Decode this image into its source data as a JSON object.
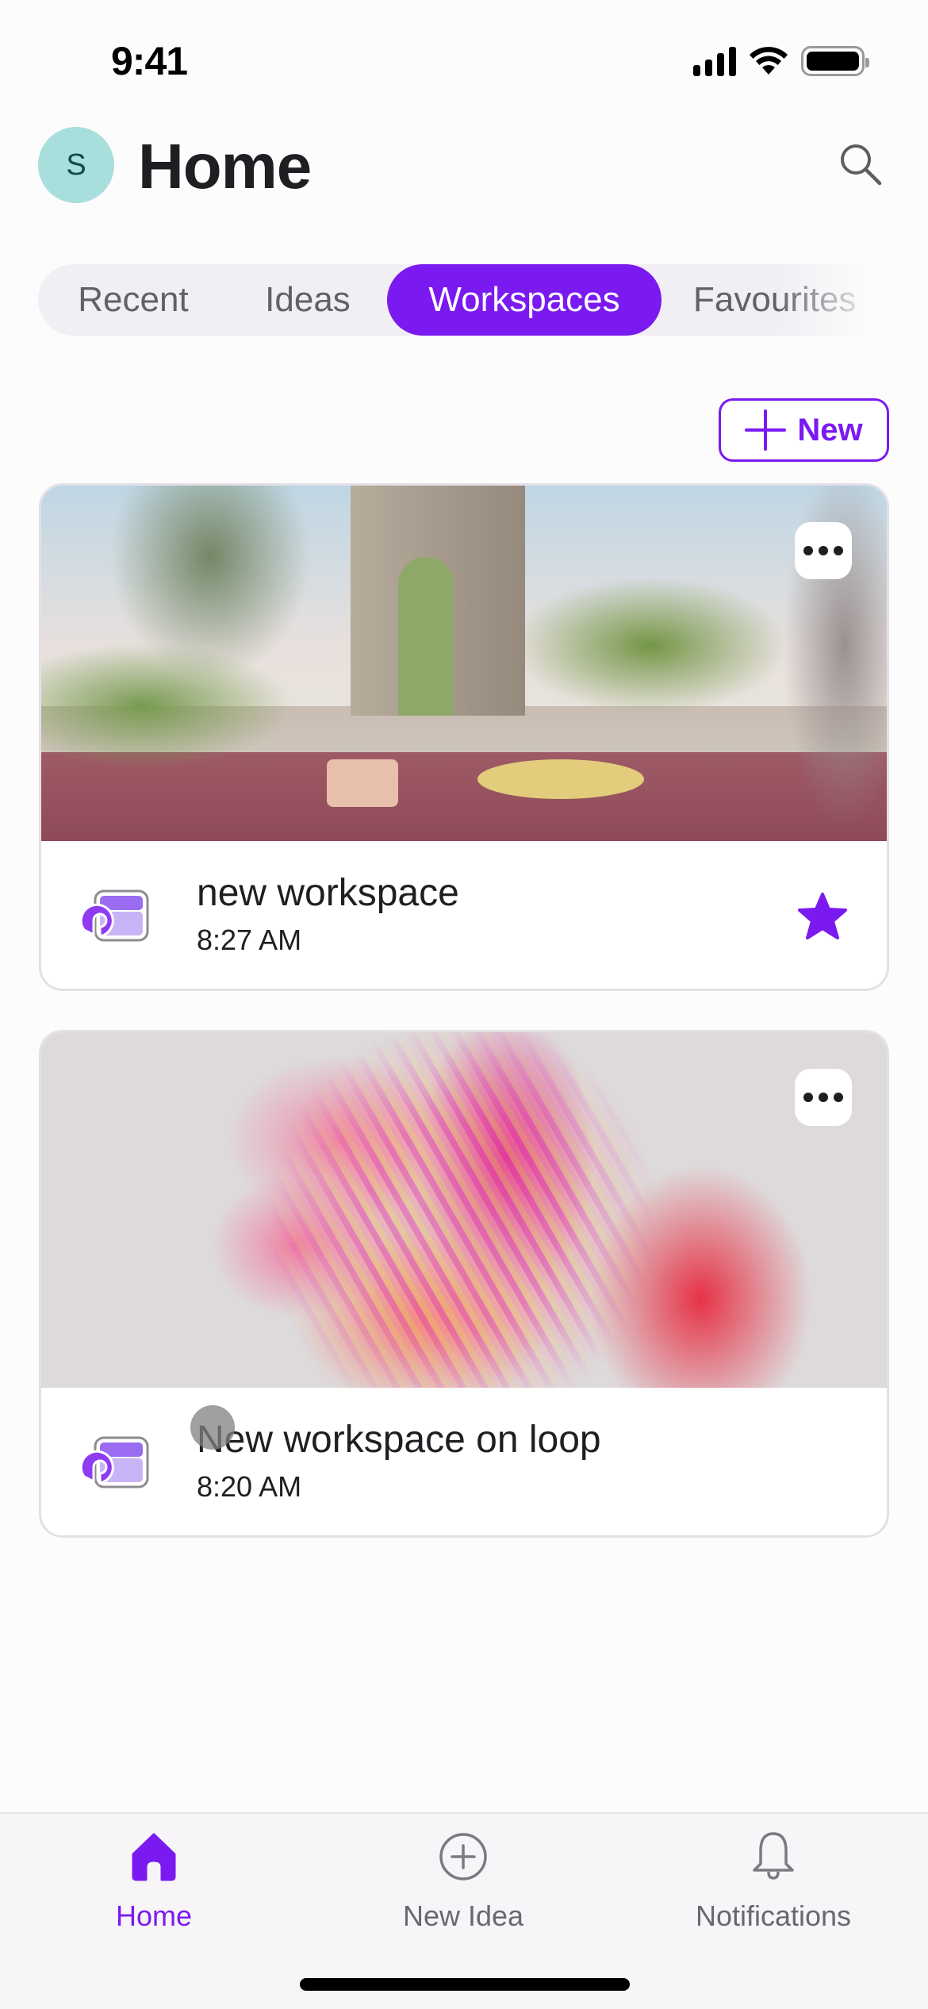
{
  "status_bar": {
    "time": "9:41",
    "icons": [
      "cellular-signal-icon",
      "wifi-icon",
      "battery-icon"
    ]
  },
  "header": {
    "avatar_initial": "S",
    "title": "Home",
    "search_icon": "search-icon"
  },
  "tabs": {
    "items": [
      {
        "label": "Recent",
        "active": false
      },
      {
        "label": "Ideas",
        "active": false
      },
      {
        "label": "Workspaces",
        "active": true
      },
      {
        "label": "Favourites",
        "active": false
      }
    ]
  },
  "actions": {
    "new_label": "New",
    "new_icon": "plus-icon"
  },
  "workspaces": [
    {
      "title": "new workspace",
      "time": "8:27 AM",
      "favourite": true,
      "cover": "garden-terrace-render",
      "more_icon": "more-horizontal-icon"
    },
    {
      "title": "New workspace on loop",
      "time": "8:20 AM",
      "favourite": false,
      "cover": "pink-abstract-swirl-render",
      "more_icon": "more-horizontal-icon"
    }
  ],
  "bottom_nav": {
    "items": [
      {
        "label": "Home",
        "icon": "home-icon",
        "active": true
      },
      {
        "label": "New Idea",
        "icon": "add-circle-icon",
        "active": false
      },
      {
        "label": "Notifications",
        "icon": "bell-icon",
        "active": false
      }
    ]
  },
  "colors": {
    "accent": "#7B1AF0",
    "avatar_bg": "#A8DEDC",
    "tab_bg": "#F1EFF3",
    "tabbar_bg": "#F7F5F8",
    "text_primary": "#1F1E22",
    "text_secondary": "#636166"
  }
}
